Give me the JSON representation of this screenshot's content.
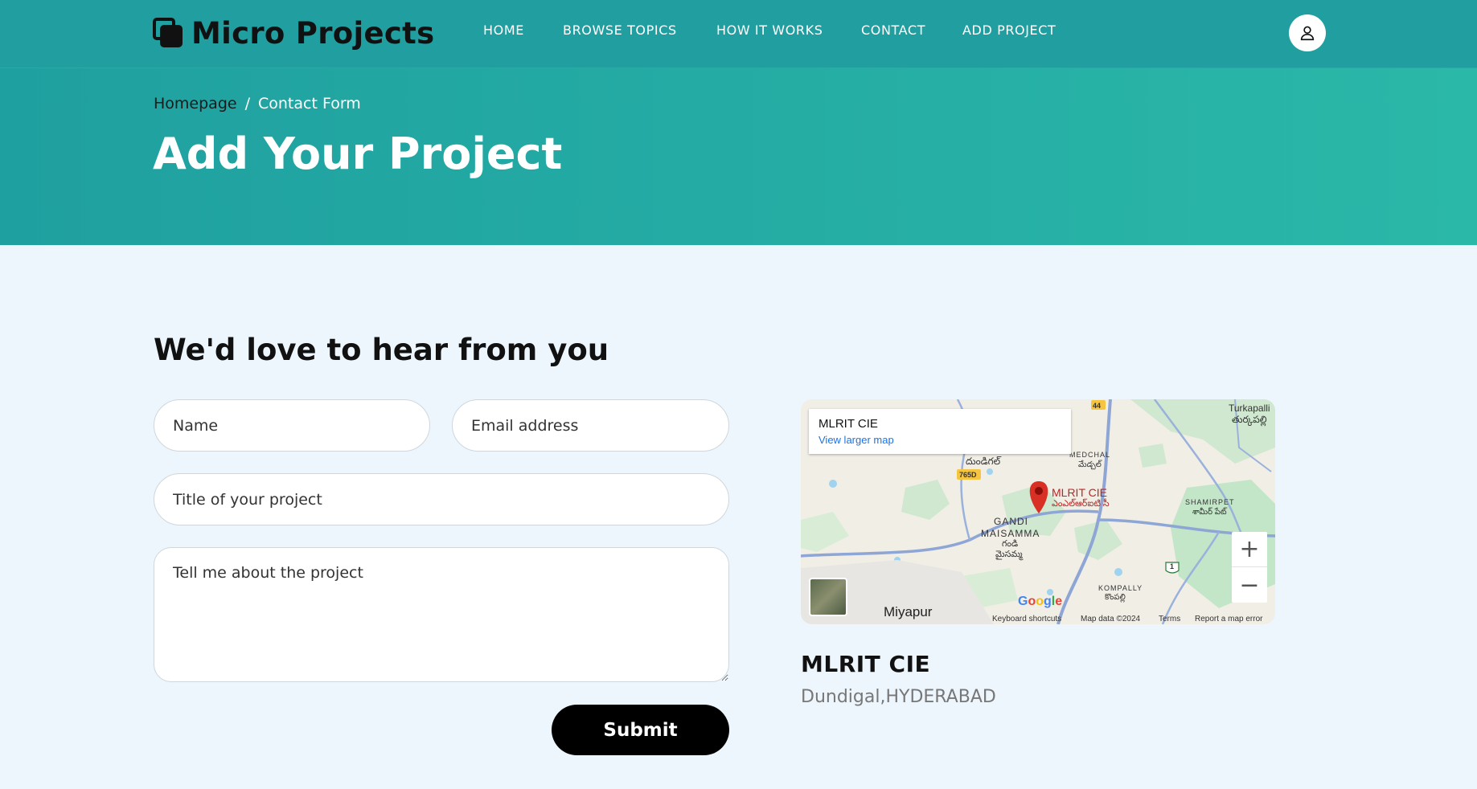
{
  "header": {
    "logo_text": "Micro Projects",
    "nav": [
      {
        "label": "HOME"
      },
      {
        "label": "BROWSE TOPICS"
      },
      {
        "label": "HOW IT WORKS"
      },
      {
        "label": "CONTACT"
      },
      {
        "label": "ADD PROJECT"
      }
    ],
    "account_icon": "user-icon"
  },
  "hero": {
    "breadcrumb": {
      "home": "Homepage",
      "separator": "/",
      "current": "Contact Form"
    },
    "title": "Add Your Project"
  },
  "form": {
    "heading": "We'd love to hear from you",
    "name_placeholder": "Name",
    "email_placeholder": "Email address",
    "title_placeholder": "Title of your project",
    "message_placeholder": "Tell me about the project",
    "submit_label": "Submit"
  },
  "map": {
    "card_title": "MLRIT CIE",
    "card_link": "View larger map",
    "marker_label": "MLRIT CIE",
    "marker_label_te": "ఎంఎల్ఆర్ఐటి సీ",
    "places": [
      {
        "name": "Turkapalli",
        "sub": "తుర్కపల్లి"
      },
      {
        "name": "MEDCHAL",
        "sub": "మేడ్చల్"
      },
      {
        "name": "దుండిగల్",
        "sub": ""
      },
      {
        "name": "GANDI",
        "sub": ""
      },
      {
        "name": "MAISAMMA",
        "sub": ""
      },
      {
        "name": "గండి",
        "sub": ""
      },
      {
        "name": "మైసమ్మ",
        "sub": ""
      },
      {
        "name": "SHAMIRPET",
        "sub": "శామీర్ పేట్"
      },
      {
        "name": "KOMPALLY",
        "sub": "కొంపల్లి"
      },
      {
        "name": "Miyapur",
        "sub": ""
      }
    ],
    "road_badges": [
      "44",
      "765D",
      "1"
    ],
    "zoom_in": "+",
    "zoom_out": "−",
    "footer": {
      "shortcuts": "Keyboard shortcuts",
      "data": "Map data ©2024",
      "terms": "Terms",
      "report": "Report a map error"
    },
    "google": "Google"
  },
  "location": {
    "name": "MLRIT CIE",
    "address": "Dundigal,HYDERABAD"
  },
  "colors": {
    "header_bg": "#219ea0",
    "hero_gradient_start": "#1fa0a0",
    "hero_gradient_end": "#2ab8a8",
    "page_bg": "#eef6fd",
    "button_bg": "#000000",
    "link_blue": "#1a73e8",
    "marker_red": "#d93025"
  }
}
